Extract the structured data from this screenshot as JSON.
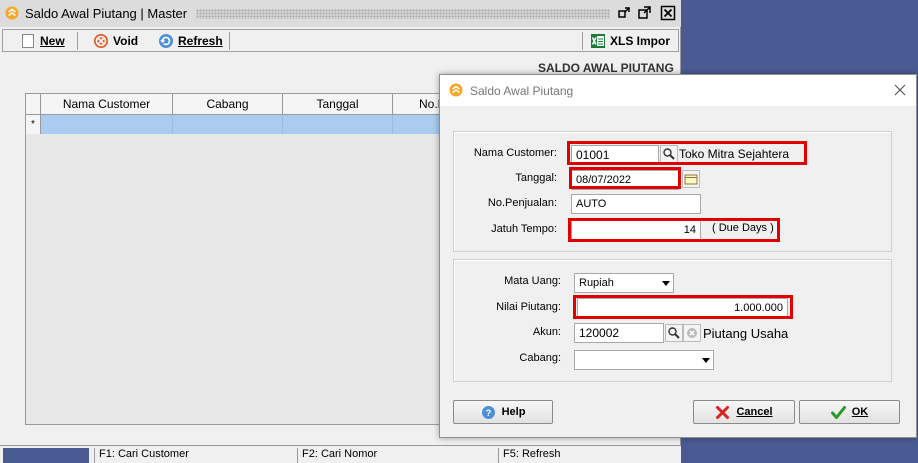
{
  "main": {
    "title": "Saldo Awal Piutang | Master",
    "toolbar": {
      "new_label": "New",
      "void_label": "Void",
      "refresh_label": "Refresh",
      "import_label": "XLS Impor"
    },
    "section_label": "SALDO AWAL PIUTANG",
    "grid": {
      "columns": [
        "Nama Customer",
        "Cabang",
        "Tanggal",
        "No.P"
      ],
      "new_row_marker": "*"
    },
    "status_bar": [
      "F1: Cari Customer",
      "F2: Cari Nomor",
      "F5: Refresh"
    ]
  },
  "dialog": {
    "title": "Saldo Awal Piutang",
    "fields": {
      "customer_label": "Nama Customer:",
      "customer_code": "01001",
      "customer_name": "Toko Mitra Sejahtera",
      "date_label": "Tanggal:",
      "date_value": "08/07/2022",
      "sales_no_label": "No.Penjualan:",
      "sales_no_value": "AUTO",
      "due_label": "Jatuh Tempo:",
      "due_value": "14",
      "due_suffix": "( Due Days )",
      "currency_label": "Mata Uang:",
      "currency_value": "Rupiah",
      "amount_label": "Nilai Piutang:",
      "amount_value": "1.000.000",
      "account_label": "Akun:",
      "account_code": "120002",
      "account_name": "Piutang Usaha",
      "branch_label": "Cabang:",
      "branch_value": ""
    },
    "buttons": {
      "help": "Help",
      "cancel": "Cancel",
      "ok": "OK"
    }
  },
  "colors": {
    "desktop": "#4a5b93",
    "highlight": "#e00000",
    "grid_selection": "#a9ccf0"
  }
}
